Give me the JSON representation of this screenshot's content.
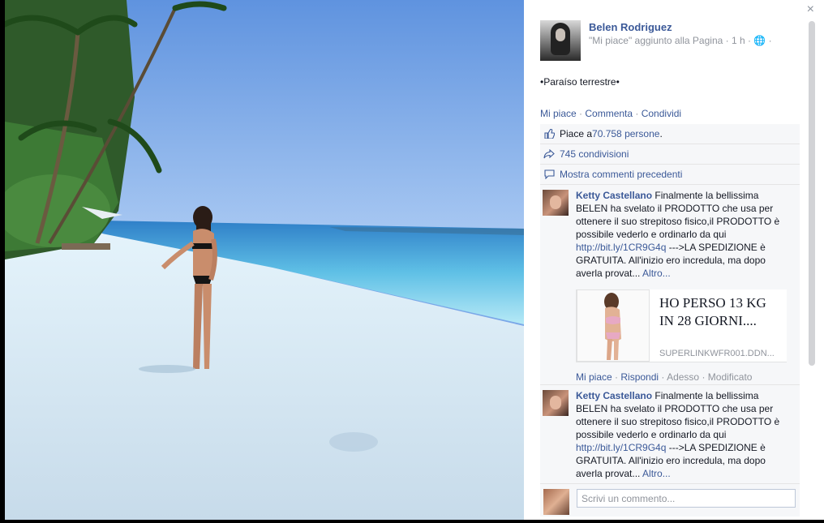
{
  "page": {
    "name": "Belen Rodriguez",
    "meta": "\"Mi piace\" aggiunto alla Pagina · 1 h · 🌐 ·",
    "close_label": "×"
  },
  "post": {
    "caption": "•Paraíso terrestre•",
    "actions": {
      "like": "Mi piace",
      "comment": "Commenta",
      "share": "Condividi",
      "sep": " · "
    }
  },
  "ufi": {
    "likes_prefix": "Piace a ",
    "likes_count": "70.758 persone",
    "likes_suffix": ".",
    "shares": "745 condivisioni",
    "previous_comments": "Mostra commenti precedenti",
    "icons": {
      "like": "thumbs-up-icon",
      "share": "share-arrow-icon",
      "comment": "comment-bubble-icon"
    }
  },
  "comments": [
    {
      "author": "Ketty Castellano",
      "text_1": " Finalmente la bellissima BELEN ha svelato il PRODOTTO che usa per ottenere il suo strepitoso fisico,il PRODOTTO è possibile vederlo e ordinarlo da qui ",
      "link": "http://bit.ly/1CR9G4q",
      "text_2": " --->LA SPEDIZIONE è GRATUITA. All'inizio ero incredula, ma dopo averla provat... ",
      "more": "Altro...",
      "share_card": {
        "title": "HO PERSO 13 KG IN 28 GIORNI....",
        "url": "SUPERLINKWFR001.DDN..."
      },
      "actions": {
        "like": "Mi piace",
        "reply": "Rispondi",
        "time": "Adesso",
        "edited": "Modificato"
      }
    },
    {
      "author": "Ketty Castellano",
      "text_1": " Finalmente la bellissima BELEN ha svelato il PRODOTTO che usa per ottenere il suo strepitoso fisico,il PRODOTTO è possibile vederlo e ordinarlo da qui ",
      "link": "http://bit.ly/1CR9G4q",
      "text_2": " --->LA SPEDIZIONE è GRATUITA. All'inizio ero incredula, ma dopo averla provat... ",
      "more": "Altro..."
    }
  ],
  "composer": {
    "placeholder": "Scrivi un commento..."
  },
  "colors": {
    "link": "#3b5998",
    "muted": "#90949c",
    "ufi_bg": "#f6f7f9"
  }
}
